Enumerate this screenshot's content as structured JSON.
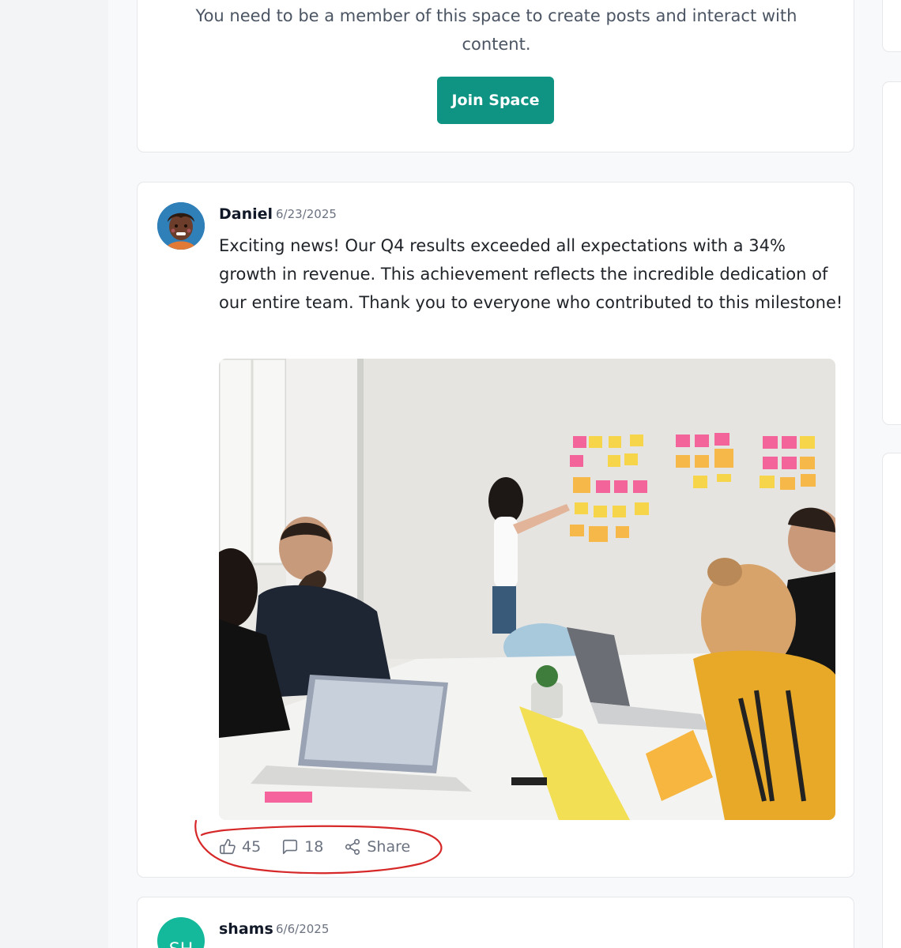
{
  "join": {
    "message": "You need to be a member of this space to create posts and interact with content.",
    "button_label": "Join Space"
  },
  "post": {
    "author": "Daniel",
    "date": "6/23/2025",
    "body": "Exciting news! Our Q4 results exceeded all expectations with a 34% growth in revenue. This achievement reflects the incredible dedication of our entire team. Thank you to everyone who contributed to this milestone!",
    "likes": "45",
    "comments": "18",
    "share_label": "Share"
  },
  "next_post": {
    "author": "shams",
    "date": "6/6/2025",
    "avatar_initials": "SH"
  },
  "icons": {
    "like": "thumbs-up-icon",
    "comment": "comment-icon",
    "share": "share-icon"
  },
  "colors": {
    "primary": "#0f9483",
    "sh_avatar": "#14b89a",
    "annotation": "#d62828"
  }
}
